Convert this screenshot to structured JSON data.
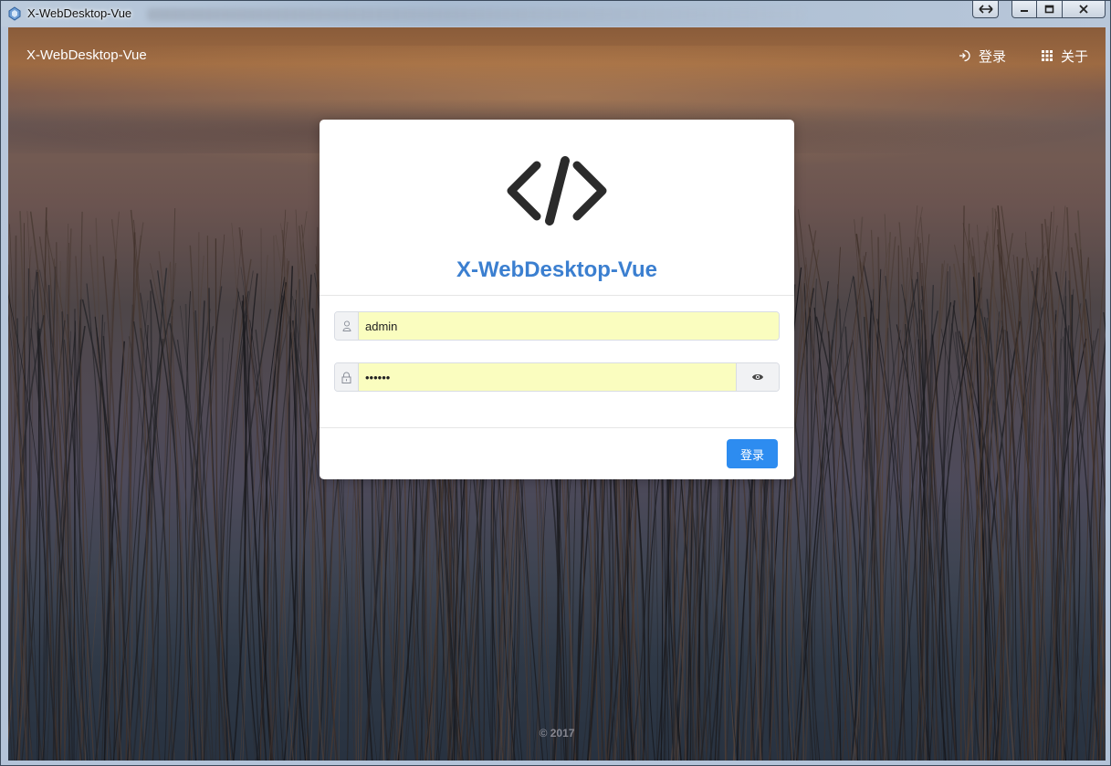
{
  "window": {
    "title": "X-WebDesktop-Vue"
  },
  "navbar": {
    "brand": "X-WebDesktop-Vue",
    "login_label": "登录",
    "about_label": "关于"
  },
  "login_card": {
    "title": "X-WebDesktop-Vue",
    "username_value": "admin",
    "password_value": "••••••",
    "submit_label": "登录"
  },
  "footer": {
    "copyright": "© 2017"
  },
  "colors": {
    "accent": "#2d8cf0",
    "title_blue": "#3b7fd0",
    "autofill_yellow": "#fafdbf"
  },
  "icons": {
    "login": "sign-in-icon",
    "about": "grid-icon",
    "user": "user-icon",
    "lock": "lock-icon",
    "eye": "eye-icon",
    "logo": "code-icon"
  }
}
